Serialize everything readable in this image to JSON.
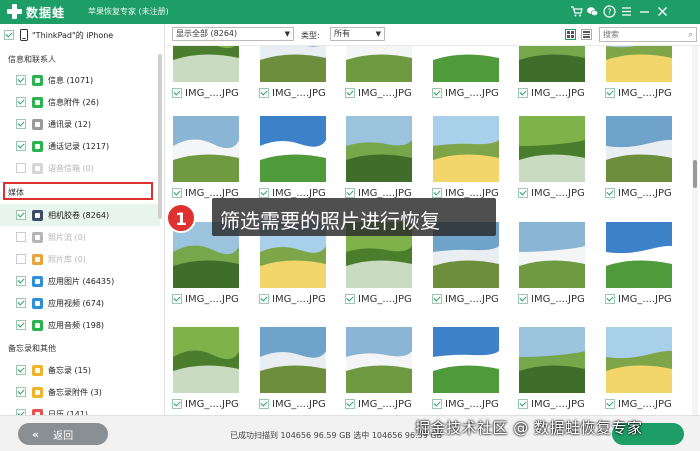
{
  "titlebar": {
    "brand": "数据蛙",
    "subtitle": "苹果恢复专家 (未注册)",
    "controls": [
      "cart-icon",
      "wechat-icon",
      "help-icon",
      "menu-icon",
      "minimize-icon",
      "close-icon"
    ]
  },
  "sidebar": {
    "device": "\"ThinkPad\"的 iPhone",
    "section_info": "信息和联系人",
    "info_items": [
      {
        "label": "信息 (1071)",
        "checked": true,
        "disabled": false,
        "icon": "message-icon",
        "color": "#2bb34f"
      },
      {
        "label": "信息附件 (26)",
        "checked": true,
        "disabled": false,
        "icon": "attachment-icon",
        "color": "#2bb34f"
      },
      {
        "label": "通讯录 (12)",
        "checked": true,
        "disabled": false,
        "icon": "contacts-icon",
        "color": "#9a9a9a"
      },
      {
        "label": "通话记录 (1217)",
        "checked": true,
        "disabled": false,
        "icon": "phone-icon",
        "color": "#2bb34f"
      },
      {
        "label": "语音信箱 (0)",
        "checked": false,
        "disabled": true,
        "icon": "voicemail-icon",
        "color": "#d6d6d6"
      }
    ],
    "section_media": "媒体",
    "media_items": [
      {
        "label": "相机胶卷 (8264)",
        "checked": true,
        "disabled": false,
        "icon": "camera-roll-icon",
        "color": "#3b4d68",
        "selected": true
      },
      {
        "label": "照片流 (0)",
        "checked": false,
        "disabled": true,
        "icon": "photo-stream-icon",
        "color": "#b6b6b6"
      },
      {
        "label": "照片库 (0)",
        "checked": false,
        "disabled": true,
        "icon": "photo-library-icon",
        "color": "#e9a53a"
      },
      {
        "label": "应用图片 (46435)",
        "checked": true,
        "disabled": false,
        "icon": "app-photo-icon",
        "color": "#2f8fd8"
      },
      {
        "label": "应用视频 (674)",
        "checked": true,
        "disabled": false,
        "icon": "app-video-icon",
        "color": "#2f8fd8"
      },
      {
        "label": "应用音频 (198)",
        "checked": true,
        "disabled": false,
        "icon": "app-audio-icon",
        "color": "#2bb34f"
      }
    ],
    "section_memo": "备忘录和其他",
    "memo_items": [
      {
        "label": "备忘录 (15)",
        "checked": true,
        "disabled": false,
        "icon": "notes-icon",
        "color": "#f0b429"
      },
      {
        "label": "备忘录附件 (3)",
        "checked": true,
        "disabled": false,
        "icon": "notes-attachment-icon",
        "color": "#f0b429"
      },
      {
        "label": "日历 (141)",
        "checked": true,
        "disabled": false,
        "icon": "calendar-icon",
        "color": "#e85050"
      }
    ]
  },
  "toolbar": {
    "filter_value": "显示全部 (8264)",
    "type_label": "类型:",
    "type_value": "所有",
    "search_placeholder": "搜索"
  },
  "grid": {
    "rows": [
      {
        "captions": [
          "IMG_....JPG",
          "IMG_....JPG",
          "IMG_....JPG",
          "IMG_....JPG",
          "IMG_....JPG",
          "IMG_....JPG"
        ]
      },
      {
        "captions": [
          "IMG_....JPG",
          "IMG_....JPG",
          "IMG_....JPG",
          "IMG_....JPG",
          "IMG_....JPG",
          "IMG_....JPG"
        ]
      },
      {
        "captions": [
          "IMG_....JPG",
          "IMG_....JPG",
          "IMG_....JPG",
          "IMG_....JPG",
          "IMG_....JPG",
          "IMG_....JPG"
        ]
      },
      {
        "captions": [
          "IMG_....JPG",
          "IMG_....JPG",
          "IMG_....JPG",
          "IMG_....JPG",
          "IMG_....JPG",
          "IMG_....JPG"
        ]
      }
    ]
  },
  "callout": {
    "badge": "1",
    "text": "筛选需要的照片进行恢复"
  },
  "footer": {
    "back_label": "返回",
    "back_icon": "double-chevron-left-icon",
    "status": "已成功扫描到 104656 96.59 GB  选中 104656 96.59 GB",
    "recover_label": ""
  },
  "watermark": "掘金技术社区 @ 数据蛙恢复专家",
  "colors": {
    "brand": "#1e9e67",
    "highlight": "#e03131"
  }
}
